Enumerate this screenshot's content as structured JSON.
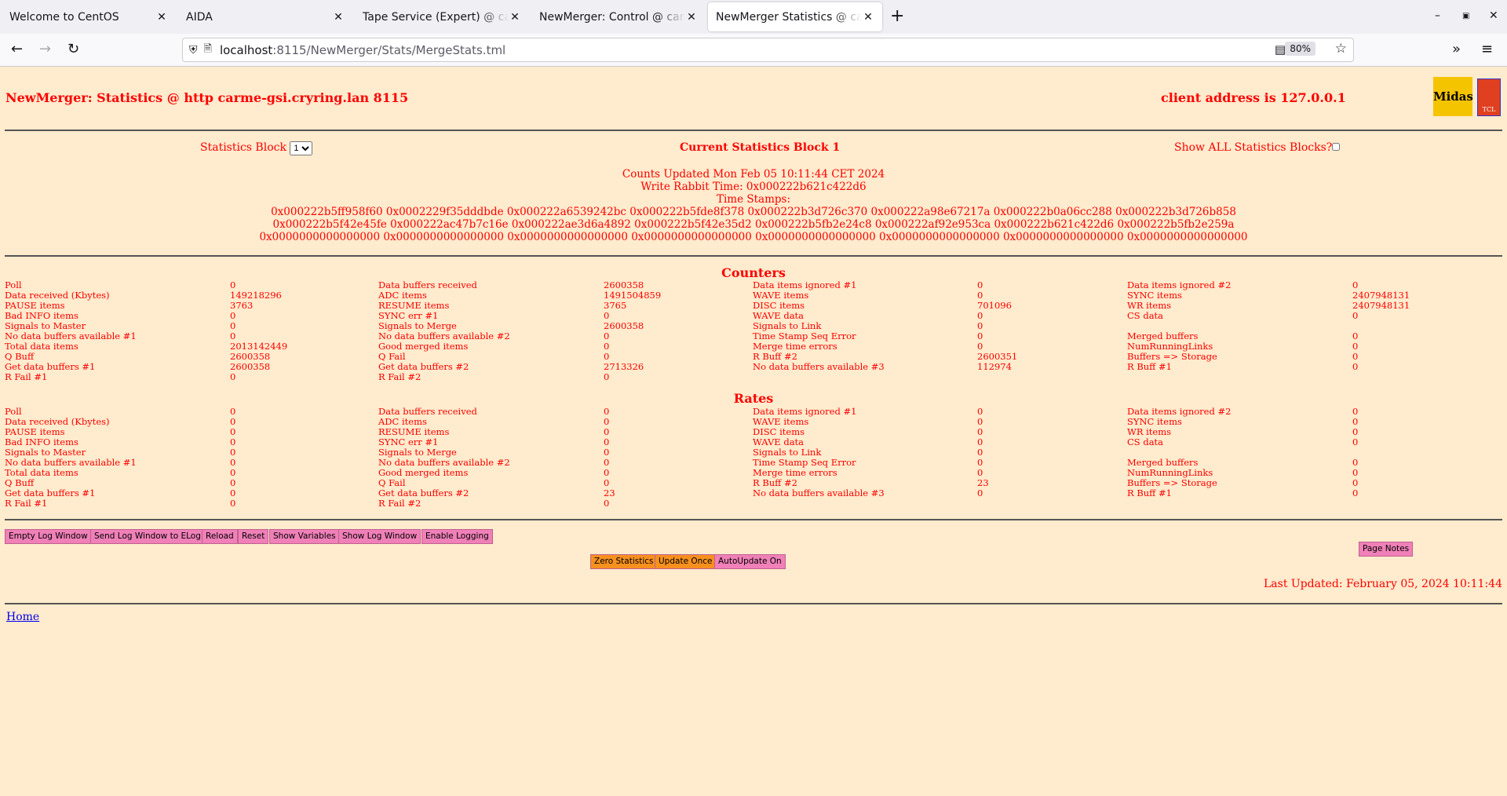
{
  "browser": {
    "tabs": [
      {
        "label": "Welcome to CentOS"
      },
      {
        "label": "AIDA"
      },
      {
        "label": "Tape Service (Expert) @ carme"
      },
      {
        "label": "NewMerger: Control @ carme"
      },
      {
        "label": "NewMerger Statistics @ carme",
        "active": true
      }
    ],
    "url_host": "localhost",
    "url_path": ":8115/NewMerger/Stats/MergeStats.tml",
    "zoom": "80%"
  },
  "header": {
    "title": "NewMerger: Statistics @ http carme-gsi.cryring.lan 8115",
    "client": "client address is 127.0.0.1",
    "logo1": "Midas",
    "logo2": "TCL"
  },
  "controls": {
    "block_label": "Statistics Block",
    "block_value": "1",
    "current": "Current Statistics Block 1",
    "show_all": "Show ALL Statistics Blocks?",
    "show_all_checked": false
  },
  "info": {
    "counts_updated": "Counts Updated Mon Feb 05 10:11:44 CET 2024",
    "write_rabbit": "Write Rabbit Time: 0x000222b621c422d6",
    "ts_label": "Time Stamps:",
    "ts_lines": [
      "0x000222b5ff958f60 0x0002229f35dddbde 0x000222a6539242bc 0x000222b5fde8f378 0x000222b3d726c370 0x000222a98e67217a 0x000222b0a06cc288 0x000222b3d726b858",
      "0x000222b5f42e45fe 0x000222ac47b7c16e 0x000222ae3d6a4892 0x000222b5f42e35d2 0x000222b5fb2e24c8 0x000222af92e953ca 0x000222b621c422d6 0x000222b5fb2e259a",
      "0x0000000000000000 0x0000000000000000 0x0000000000000000 0x0000000000000000 0x0000000000000000 0x0000000000000000 0x0000000000000000 0x0000000000000000"
    ]
  },
  "counters": {
    "title": "Counters",
    "rows": [
      [
        [
          "Poll",
          "0"
        ],
        [
          "Data buffers received",
          "2600358"
        ],
        [
          "Data items ignored #1",
          "0"
        ],
        [
          "Data items ignored #2",
          "0"
        ]
      ],
      [
        [
          "Data received (Kbytes)",
          "149218296"
        ],
        [
          "ADC items",
          "1491504859"
        ],
        [
          "WAVE items",
          "0"
        ],
        [
          "SYNC items",
          "2407948131"
        ]
      ],
      [
        [
          "PAUSE items",
          "3763"
        ],
        [
          "RESUME items",
          "3765"
        ],
        [
          "DISC items",
          "701096"
        ],
        [
          "WR items",
          "2407948131"
        ]
      ],
      [
        [
          "Bad INFO items",
          "0"
        ],
        [
          "SYNC err #1",
          "0"
        ],
        [
          "WAVE data",
          "0"
        ],
        [
          "CS data",
          "0"
        ]
      ],
      [
        [
          "Signals to Master",
          "0"
        ],
        [
          "Signals to Merge",
          "2600358"
        ],
        [
          "Signals to Link",
          "0"
        ],
        [
          "",
          ""
        ]
      ],
      [
        [
          "No data buffers available #1",
          "0"
        ],
        [
          "No data buffers available #2",
          "0"
        ],
        [
          "Time Stamp Seq Error",
          "0"
        ],
        [
          "Merged buffers",
          "0"
        ]
      ],
      [
        [
          "Total data items",
          "2013142449"
        ],
        [
          "Good merged items",
          "0"
        ],
        [
          "Merge time errors",
          "0"
        ],
        [
          "NumRunningLinks",
          "0"
        ]
      ],
      [
        [
          "Q Buff",
          "2600358"
        ],
        [
          "Q Fail",
          "0"
        ],
        [
          "R Buff #2",
          "2600351"
        ],
        [
          "Buffers => Storage",
          "0"
        ]
      ],
      [
        [
          "Get data buffers #1",
          "2600358"
        ],
        [
          "Get data buffers #2",
          "2713326"
        ],
        [
          "No data buffers available #3",
          "112974"
        ],
        [
          "R Buff #1",
          "0"
        ]
      ],
      [
        [
          "R Fail #1",
          "0"
        ],
        [
          "R Fail #2",
          "0"
        ],
        [
          "",
          ""
        ],
        [
          "",
          ""
        ]
      ]
    ]
  },
  "rates": {
    "title": "Rates",
    "rows": [
      [
        [
          "Poll",
          "0"
        ],
        [
          "Data buffers received",
          "0"
        ],
        [
          "Data items ignored #1",
          "0"
        ],
        [
          "Data items ignored #2",
          "0"
        ]
      ],
      [
        [
          "Data received (Kbytes)",
          "0"
        ],
        [
          "ADC items",
          "0"
        ],
        [
          "WAVE items",
          "0"
        ],
        [
          "SYNC items",
          "0"
        ]
      ],
      [
        [
          "PAUSE items",
          "0"
        ],
        [
          "RESUME items",
          "0"
        ],
        [
          "DISC items",
          "0"
        ],
        [
          "WR items",
          "0"
        ]
      ],
      [
        [
          "Bad INFO items",
          "0"
        ],
        [
          "SYNC err #1",
          "0"
        ],
        [
          "WAVE data",
          "0"
        ],
        [
          "CS data",
          "0"
        ]
      ],
      [
        [
          "Signals to Master",
          "0"
        ],
        [
          "Signals to Merge",
          "0"
        ],
        [
          "Signals to Link",
          "0"
        ],
        [
          "",
          ""
        ]
      ],
      [
        [
          "No data buffers available #1",
          "0"
        ],
        [
          "No data buffers available #2",
          "0"
        ],
        [
          "Time Stamp Seq Error",
          "0"
        ],
        [
          "Merged buffers",
          "0"
        ]
      ],
      [
        [
          "Total data items",
          "0"
        ],
        [
          "Good merged items",
          "0"
        ],
        [
          "Merge time errors",
          "0"
        ],
        [
          "NumRunningLinks",
          "0"
        ]
      ],
      [
        [
          "Q Buff",
          "0"
        ],
        [
          "Q Fail",
          "0"
        ],
        [
          "R Buff #2",
          "23"
        ],
        [
          "Buffers => Storage",
          "0"
        ]
      ],
      [
        [
          "Get data buffers #1",
          "0"
        ],
        [
          "Get data buffers #2",
          "23"
        ],
        [
          "No data buffers available #3",
          "0"
        ],
        [
          "R Buff #1",
          "0"
        ]
      ],
      [
        [
          "R Fail #1",
          "0"
        ],
        [
          "R Fail #2",
          "0"
        ],
        [
          "",
          ""
        ],
        [
          "",
          ""
        ]
      ]
    ]
  },
  "buttons": {
    "row1": [
      "Empty Log Window",
      "Send Log Window to ELog",
      "Reload",
      "Reset",
      "Show Variables",
      "Show Log Window",
      "Enable Logging"
    ],
    "row2": [
      {
        "label": "Zero Statistics",
        "color": "#f7901e"
      },
      {
        "label": "Update Once",
        "color": "#f7901e"
      },
      {
        "label": "AutoUpdate On",
        "color": "#f080b8"
      }
    ],
    "page_notes": "Page Notes"
  },
  "footer": {
    "last_updated": "Last Updated: February 05, 2024 10:11:44",
    "home": "Home"
  },
  "colors": {
    "text": "#ff0000",
    "background": "#ffebcd"
  }
}
